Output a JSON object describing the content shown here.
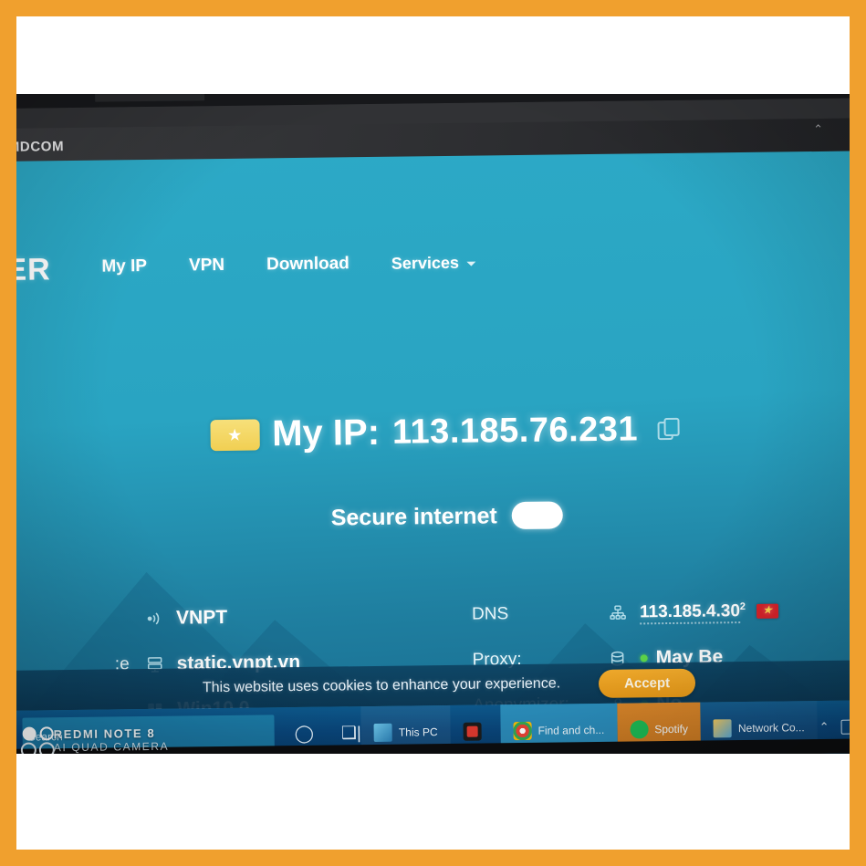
{
  "frame": {
    "accent_color": "#f0a02e",
    "card_color": "#ffffff"
  },
  "browser": {
    "address_text": "MDCOM",
    "window_controls": "⌃ ⌄"
  },
  "site": {
    "logo": "ER",
    "brand_bg": "#2ba8c4",
    "nav": [
      {
        "label": "My IP"
      },
      {
        "label": "VPN"
      },
      {
        "label": "Download"
      },
      {
        "label": "Services",
        "has_dropdown": true
      }
    ],
    "hero": {
      "star_icon": "star-icon",
      "label": "My IP:",
      "ip": "113.185.76.231",
      "copy_icon": "copy-icon"
    },
    "secure": {
      "label": "Secure internet",
      "toggle_state": "on"
    },
    "info_left": [
      {
        "label": "",
        "icon": "broadcast-icon",
        "value": "VNPT"
      },
      {
        "label": "e:",
        "icon": "server-icon",
        "value": "static.vnpt.vn"
      },
      {
        "label": "",
        "icon": "windows-icon",
        "value": "Win10.0"
      }
    ],
    "info_right": [
      {
        "label": "DNS",
        "icon": "dns-network-icon",
        "value": "113.185.4.30",
        "sup": "2",
        "flag": "vietnam-flag",
        "status": ""
      },
      {
        "label": "Proxy:",
        "icon": "database-icon",
        "value": "May Be",
        "status_color": "#5ed94a"
      },
      {
        "label": "Anonymizer:",
        "icon": "user-shield-icon",
        "value": "No",
        "status_color": "#5ed94a"
      }
    ],
    "cookie": {
      "text": "This website uses cookies to enhance your experience.",
      "accept_label": "Accept"
    }
  },
  "taskbar": {
    "search_placeholder": "Search",
    "cortana_icon": "circle-icon",
    "taskview_icon": "task-view-icon",
    "apps": [
      {
        "name": "This PC",
        "icon": "this-pc-icon"
      },
      {
        "name": "",
        "icon": "red-app-icon"
      },
      {
        "name": "Find and ch...",
        "icon": "chrome-icon"
      },
      {
        "name": "Spotify",
        "icon": "spotify-icon"
      },
      {
        "name": "Network Co...",
        "icon": "network-icon"
      }
    ],
    "tray": {
      "chevron": "⌃",
      "keyboard_icon": "keyboard-icon"
    }
  },
  "watermark": {
    "line1": "REDMI NOTE 8",
    "line2": "AI QUAD CAMERA"
  }
}
